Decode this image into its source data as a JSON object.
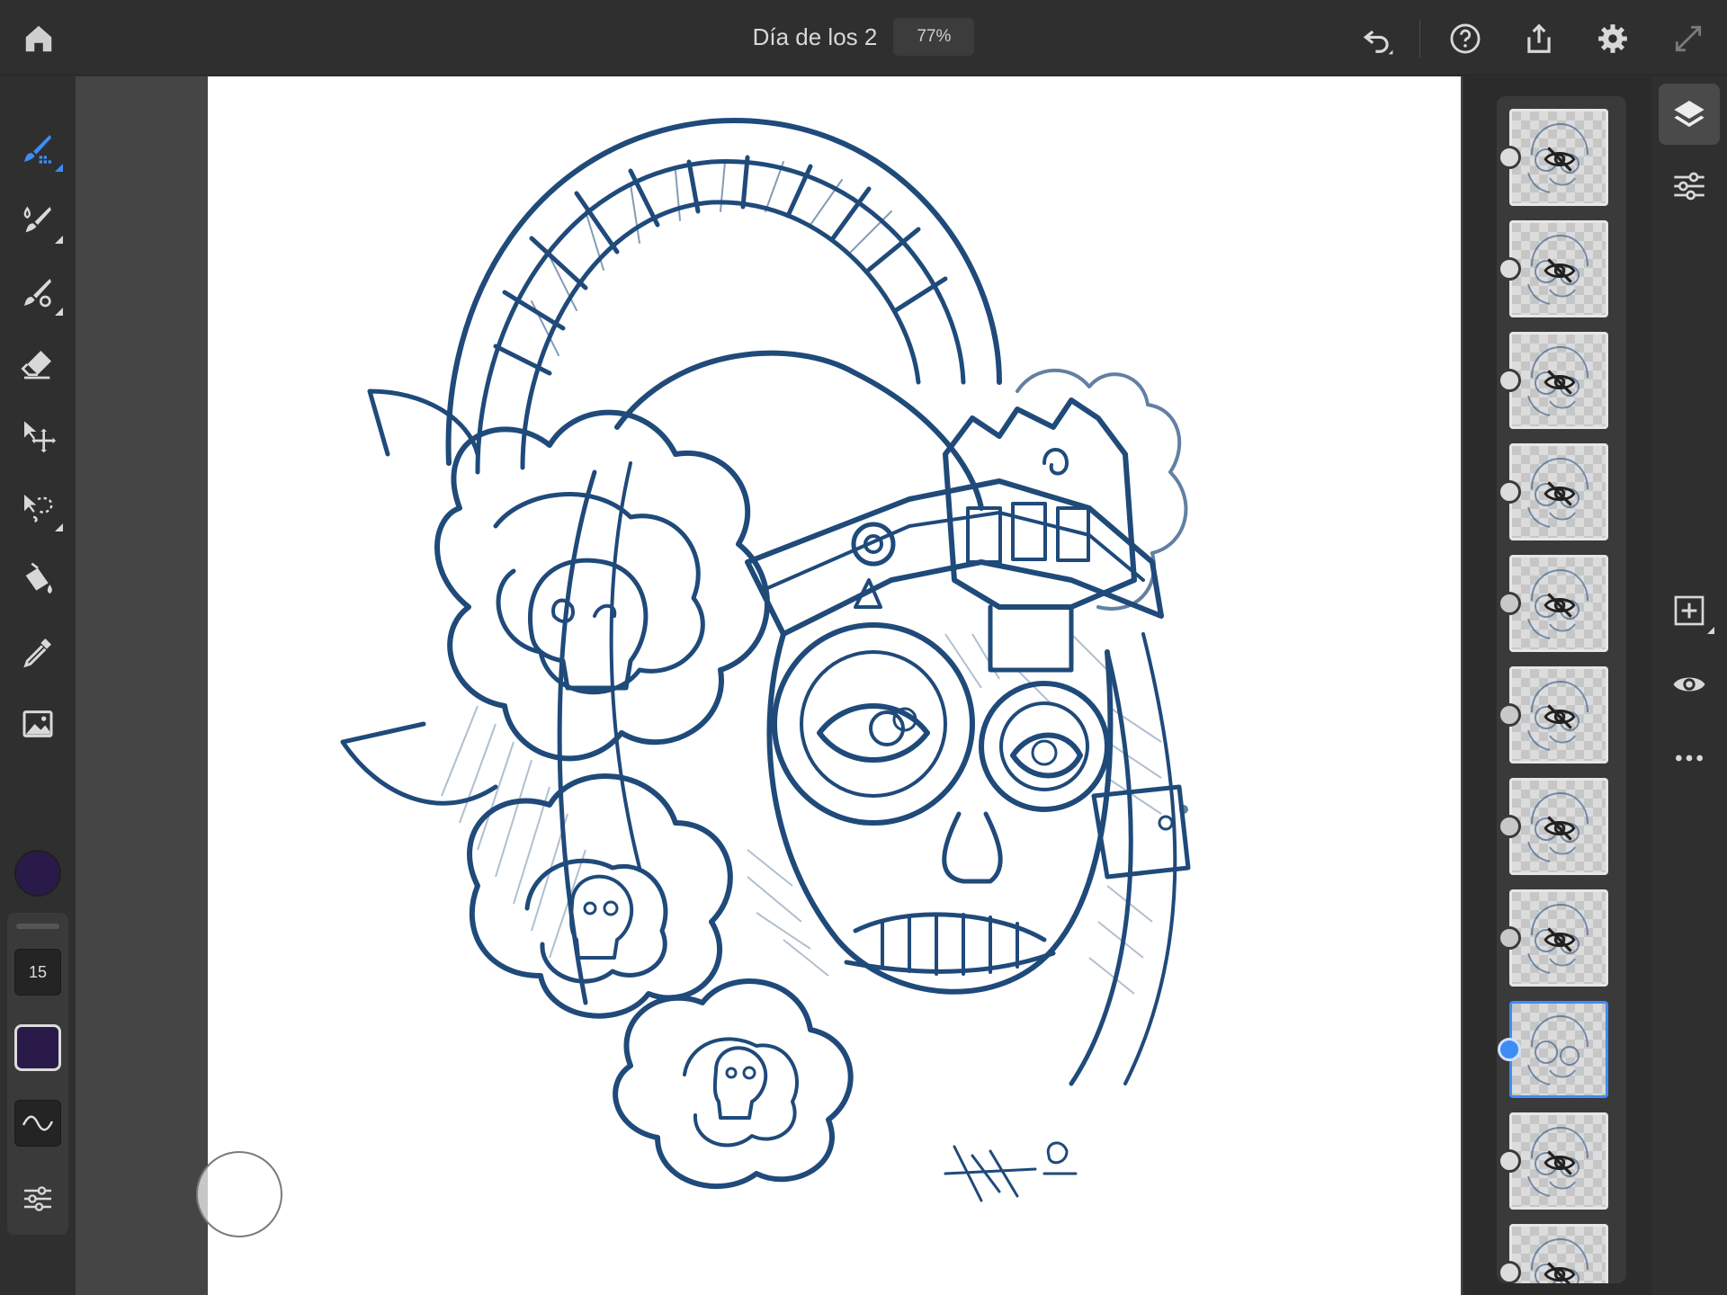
{
  "header": {
    "document_title": "Día de los 2",
    "zoom": "77%",
    "buttons": {
      "home": "home-icon",
      "undo": "undo-icon",
      "help": "help-icon",
      "share": "share-icon",
      "settings": "gear-icon",
      "fullscreen": "expand-icon"
    }
  },
  "tools": [
    {
      "name": "pixel-brush",
      "icon": "pixel-brush-icon",
      "active": true
    },
    {
      "name": "live-brush",
      "icon": "live-brush-icon",
      "active": false
    },
    {
      "name": "vector-brush",
      "icon": "vector-brush-icon",
      "active": false
    },
    {
      "name": "eraser",
      "icon": "eraser-icon",
      "active": false
    },
    {
      "name": "transform",
      "icon": "transform-icon",
      "active": false
    },
    {
      "name": "selection",
      "icon": "lasso-icon",
      "active": false
    },
    {
      "name": "fill",
      "icon": "fill-bucket-icon",
      "active": false
    },
    {
      "name": "eyedropper",
      "icon": "eyedropper-icon",
      "active": false
    },
    {
      "name": "image",
      "icon": "image-icon",
      "active": false
    }
  ],
  "current_color": "#2a1a4a",
  "brush_panel": {
    "size": "15",
    "color": "#2a1a4a",
    "smoothing_icon": "wave-icon",
    "settings_icon": "sliders-icon"
  },
  "colors": {
    "accent": "#3d8df5",
    "ink": "#1f4a7a"
  },
  "layers": [
    {
      "visible": false,
      "selected": false,
      "handle": "grid"
    },
    {
      "visible": false,
      "selected": false,
      "handle": "grid"
    },
    {
      "visible": false,
      "selected": false,
      "handle": "grid"
    },
    {
      "visible": false,
      "selected": false,
      "handle": "grid"
    },
    {
      "visible": false,
      "selected": false,
      "handle": "plain"
    },
    {
      "visible": false,
      "selected": false,
      "handle": "plain"
    },
    {
      "visible": false,
      "selected": false,
      "handle": "plain"
    },
    {
      "visible": false,
      "selected": false,
      "handle": "plain"
    },
    {
      "visible": true,
      "selected": true,
      "handle": "grid"
    },
    {
      "visible": false,
      "selected": false,
      "handle": "grid"
    },
    {
      "visible": false,
      "selected": false,
      "handle": "grid"
    }
  ],
  "right_rail": [
    {
      "name": "layers",
      "icon": "layers-icon",
      "active": true
    },
    {
      "name": "layer-properties",
      "icon": "adjustments-icon",
      "active": false
    },
    {
      "name": "add-layer",
      "icon": "add-layer-icon",
      "active": false
    },
    {
      "name": "visibility",
      "icon": "eye-icon",
      "active": false
    },
    {
      "name": "more",
      "icon": "more-icon",
      "active": false
    }
  ]
}
